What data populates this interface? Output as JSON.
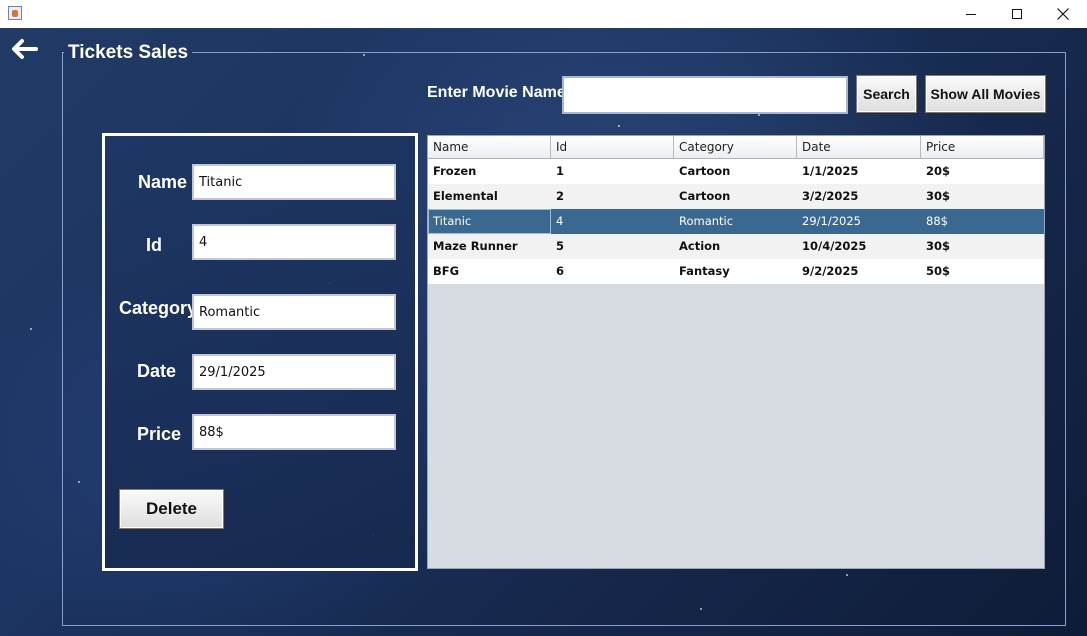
{
  "window": {
    "minimize_icon": "minimize-icon",
    "maximize_icon": "maximize-icon",
    "close_icon": "close-icon"
  },
  "panel": {
    "title": "Tickets Sales"
  },
  "search": {
    "label": "Enter Movie Name",
    "value": "",
    "placeholder": "",
    "search_button": "Search",
    "show_all_button": "Show All Movies"
  },
  "form": {
    "name_label": "Name",
    "name_value": "Titanic",
    "id_label": "Id",
    "id_value": "4",
    "category_label": "Category",
    "category_value": "Romantic",
    "date_label": "Date",
    "date_value": "29/1/2025",
    "price_label": "Price",
    "price_value": "88$",
    "delete_button": "Delete"
  },
  "table": {
    "columns": [
      "Name",
      "Id",
      "Category",
      "Date",
      "Price"
    ],
    "rows": [
      [
        "Frozen",
        "1",
        "Cartoon",
        "1/1/2025",
        "20$"
      ],
      [
        "Elemental",
        "2",
        "Cartoon",
        "3/2/2025",
        "30$"
      ],
      [
        "Titanic",
        "4",
        "Romantic",
        "29/1/2025",
        "88$"
      ],
      [
        "Maze Runner",
        "5",
        "Action",
        "10/4/2025",
        "30$"
      ],
      [
        "BFG",
        "6",
        "Fantasy",
        "9/2/2025",
        "50$"
      ]
    ],
    "selected_row": 2
  },
  "colors": {
    "background": "#1b2e55",
    "selected_row": "#3a6891",
    "panel_border": "#ffffff"
  }
}
